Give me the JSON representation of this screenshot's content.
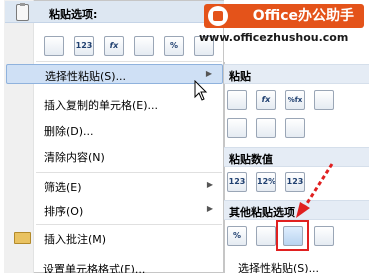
{
  "watermark": {
    "brand": "Office办公助手",
    "url": "www.officezhushou.com"
  },
  "menu": {
    "paste_options_header": "粘贴选项:",
    "paste_icons": [
      "paste-icon",
      "values-123-icon",
      "formula-fx-icon",
      "paste-link-icon",
      "percent-format-icon",
      "link-chain-icon"
    ],
    "paste_icon_texts": [
      "",
      "123",
      "fx",
      "",
      "%",
      ""
    ],
    "items": [
      {
        "label": "选择性粘贴(S)...",
        "has_submenu": true
      },
      {
        "label": "插入复制的单元格(E)..."
      },
      {
        "label": "删除(D)..."
      },
      {
        "label": "清除内容(N)"
      },
      {
        "label": "筛选(E)",
        "has_submenu": true
      },
      {
        "label": "排序(O)",
        "has_submenu": true
      },
      {
        "label": "插入批注(M)"
      },
      {
        "label": "设置单元格格式(F)..."
      }
    ]
  },
  "submenu": {
    "paste_header": "粘贴",
    "paste_values_header": "粘贴数值",
    "other_paste_header": "其他粘贴选项",
    "bottom_label": "选择性粘贴(S)...",
    "paste_icon_texts": [
      "",
      "fx",
      "%fx",
      "",
      "",
      "",
      ""
    ],
    "value_icon_texts": [
      "123",
      "12%",
      "123"
    ],
    "other_icon_texts": [
      "%",
      "",
      "",
      ""
    ]
  },
  "colors": {
    "highlight": "#cfe0f5",
    "watermark_bg": "#e4531a",
    "annotation": "#e02020"
  }
}
